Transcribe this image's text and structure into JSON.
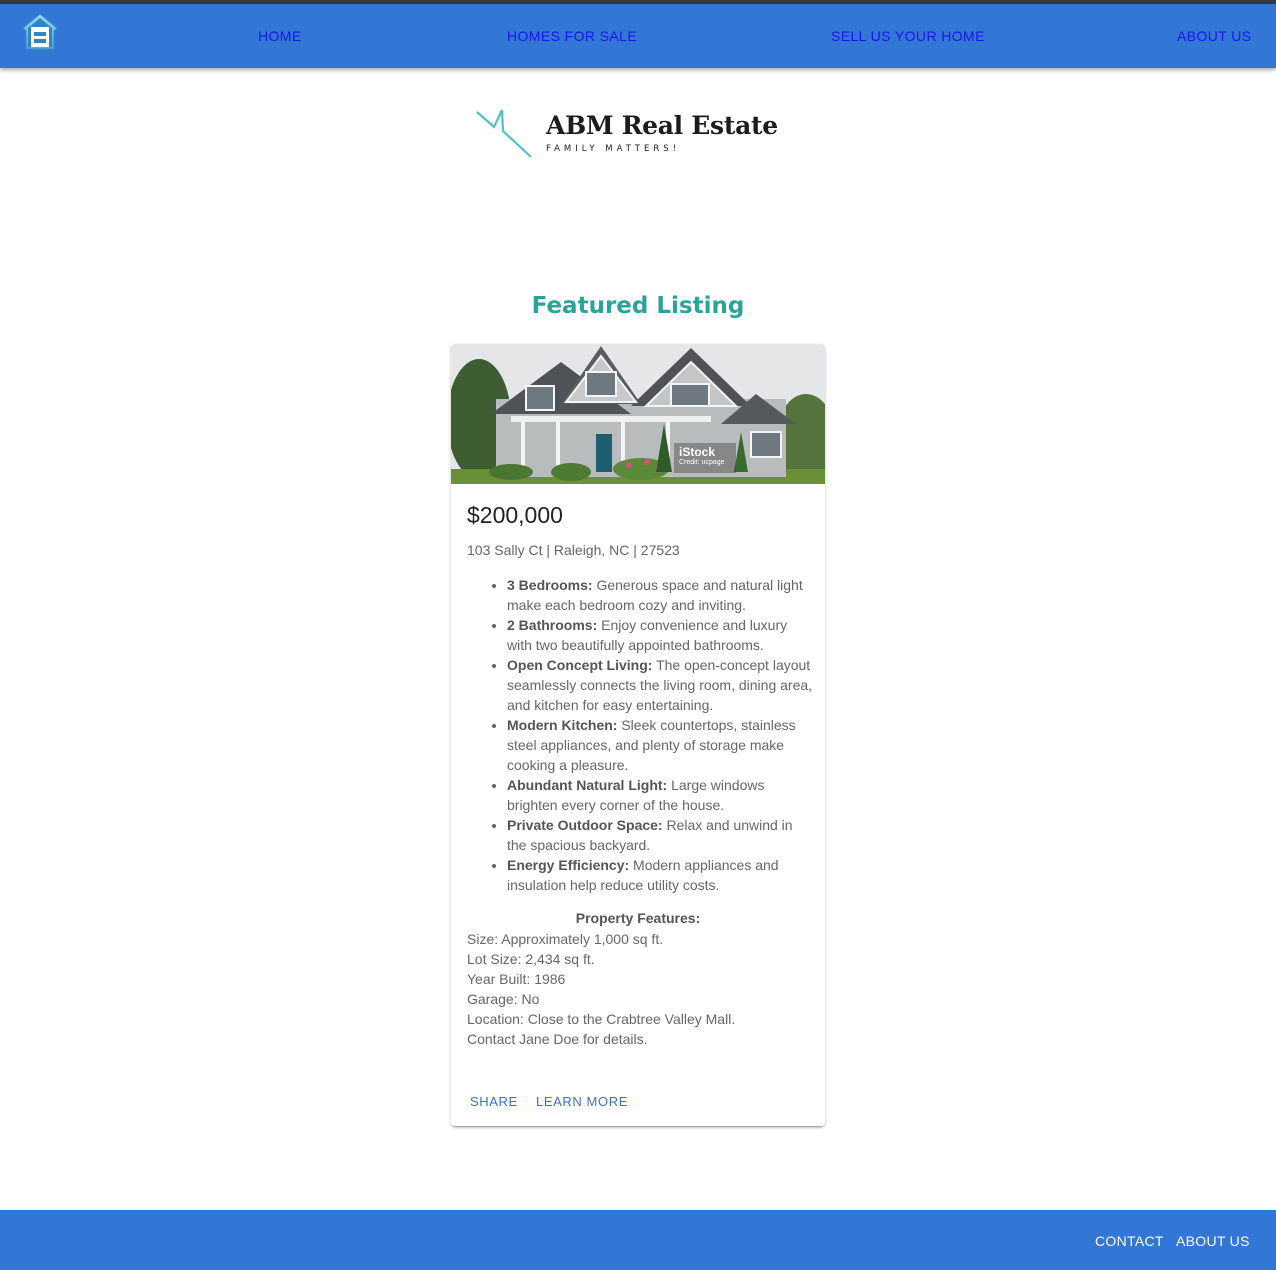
{
  "nav": {
    "home": "HOME",
    "homes_for_sale": "HOMES FOR SALE",
    "sell": "SELL US YOUR HOME",
    "about": "ABOUT US"
  },
  "logo": {
    "title": "ABM Real Estate",
    "tagline": "FAMILY MATTERS!"
  },
  "featured": {
    "heading": "Featured Listing",
    "image_watermark": "iStock",
    "image_credit": "Credit: ucpage",
    "price": "$200,000",
    "address": "103 Sally Ct | Raleigh, NC | 27523",
    "features": [
      {
        "label": "3 Bedrooms:",
        "text": " Generous space and natural light make each bedroom cozy and inviting."
      },
      {
        "label": "2 Bathrooms:",
        "text": " Enjoy convenience and luxury with two beautifully appointed bathrooms."
      },
      {
        "label": "Open Concept Living:",
        "text": " The open-concept layout seamlessly connects the living room, dining area, and kitchen for easy entertaining."
      },
      {
        "label": "Modern Kitchen:",
        "text": " Sleek countertops, stainless steel appliances, and plenty of storage make cooking a pleasure."
      },
      {
        "label": "Abundant Natural Light:",
        "text": " Large windows brighten every corner of the house."
      },
      {
        "label": "Private Outdoor Space:",
        "text": " Relax and unwind in the spacious backyard."
      },
      {
        "label": "Energy Efficiency:",
        "text": " Modern appliances and insulation help reduce utility costs."
      }
    ],
    "property_heading": "Property Features:",
    "property_lines": [
      "Size: Approximately 1,000 sq ft.",
      "Lot Size: 2,434 sq ft.",
      "Year Built: 1986",
      "Garage: No",
      "Location: Close to the Crabtree Valley Mall.",
      "Contact Jane Doe for details."
    ],
    "share_label": "SHARE",
    "learn_more_label": "LEARN MORE"
  },
  "footer": {
    "contact": "CONTACT",
    "about": "ABOUT US"
  },
  "colors": {
    "nav_bg": "#3276d6",
    "nav_link": "#1a16e8",
    "heading_teal": "#2aa39a",
    "card_button": "#3f6fc9"
  }
}
